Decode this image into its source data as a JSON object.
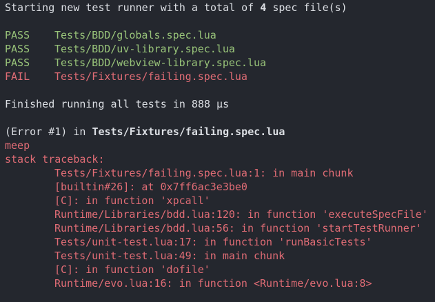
{
  "header": {
    "prefix": "Starting new test runner with a total of ",
    "count": "4",
    "suffix": " spec file(s)"
  },
  "results": [
    {
      "status": "PASS",
      "file": "Tests/BDD/globals.spec.lua"
    },
    {
      "status": "PASS",
      "file": "Tests/BDD/uv-library.spec.lua"
    },
    {
      "status": "PASS",
      "file": "Tests/BDD/webview-library.spec.lua"
    },
    {
      "status": "FAIL",
      "file": "Tests/Fixtures/failing.spec.lua"
    }
  ],
  "summary": "Finished running all tests in 888 µs",
  "error": {
    "prefix": "(Error #1) in ",
    "file": "Tests/Fixtures/failing.spec.lua",
    "message": "meep",
    "traceback_label": "stack traceback:",
    "traceback": [
      "Tests/Fixtures/failing.spec.lua:1: in main chunk",
      "[builtin#26]: at 0x7ff6ac3e3be0",
      "[C]: in function 'xpcall'",
      "Runtime/Libraries/bdd.lua:120: in function 'executeSpecFile'",
      "Runtime/Libraries/bdd.lua:56: in function 'startTestRunner'",
      "Tests/unit-test.lua:17: in function 'runBasicTests'",
      "Tests/unit-test.lua:49: in main chunk",
      "[C]: in function 'dofile'",
      "Runtime/evo.lua:16: in function <Runtime/evo.lua:8>"
    ]
  },
  "colors": {
    "background": "#24272e",
    "text": "#dcdfe4",
    "pass": "#98c379",
    "fail": "#e06c75"
  }
}
